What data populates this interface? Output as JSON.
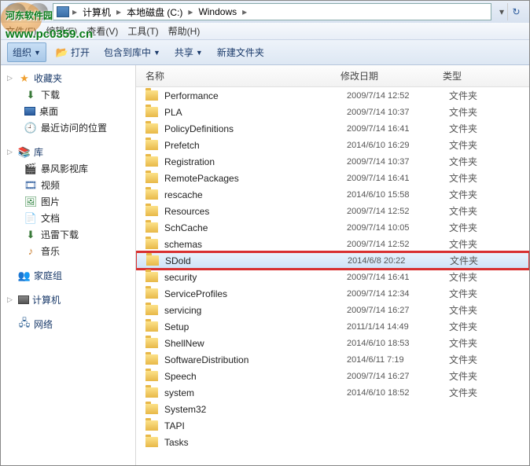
{
  "watermark": {
    "text": "河东软件园",
    "url": "www.pc0359.cn"
  },
  "breadcrumb": {
    "items": [
      "计算机",
      "本地磁盘 (C:)",
      "Windows"
    ]
  },
  "menubar": {
    "file": "文件(F)",
    "edit": "编辑(E)",
    "view": "查看(V)",
    "tools": "工具(T)",
    "help": "帮助(H)"
  },
  "toolbar": {
    "organize": "组织",
    "open": "打开",
    "include": "包含到库中",
    "share": "共享",
    "newfolder": "新建文件夹"
  },
  "sidebar": {
    "favorites": {
      "label": "收藏夹",
      "items": [
        {
          "icon": "download-icon",
          "label": "下载"
        },
        {
          "icon": "desktop-icon",
          "label": "桌面"
        },
        {
          "icon": "recent-icon",
          "label": "最近访问的位置"
        }
      ]
    },
    "libraries": {
      "label": "库",
      "items": [
        {
          "icon": "video-lib-icon",
          "label": "暴风影视库"
        },
        {
          "icon": "video-icon",
          "label": "视频"
        },
        {
          "icon": "picture-icon",
          "label": "图片"
        },
        {
          "icon": "document-icon",
          "label": "文档"
        },
        {
          "icon": "thunder-icon",
          "label": "迅雷下载"
        },
        {
          "icon": "music-icon",
          "label": "音乐"
        }
      ]
    },
    "homegroup": {
      "label": "家庭组"
    },
    "computer": {
      "label": "计算机"
    },
    "network": {
      "label": "网络"
    }
  },
  "columns": {
    "name": "名称",
    "date": "修改日期",
    "type": "类型"
  },
  "files": [
    {
      "name": "Performance",
      "date": "2009/7/14 12:52",
      "type": "文件夹"
    },
    {
      "name": "PLA",
      "date": "2009/7/14 10:37",
      "type": "文件夹"
    },
    {
      "name": "PolicyDefinitions",
      "date": "2009/7/14 16:41",
      "type": "文件夹"
    },
    {
      "name": "Prefetch",
      "date": "2014/6/10 16:29",
      "type": "文件夹"
    },
    {
      "name": "Registration",
      "date": "2009/7/14 10:37",
      "type": "文件夹"
    },
    {
      "name": "RemotePackages",
      "date": "2009/7/14 16:41",
      "type": "文件夹"
    },
    {
      "name": "rescache",
      "date": "2014/6/10 15:58",
      "type": "文件夹"
    },
    {
      "name": "Resources",
      "date": "2009/7/14 12:52",
      "type": "文件夹"
    },
    {
      "name": "SchCache",
      "date": "2009/7/14 10:05",
      "type": "文件夹"
    },
    {
      "name": "schemas",
      "date": "2009/7/14 12:52",
      "type": "文件夹"
    },
    {
      "name": "SDold",
      "date": "2014/6/8 20:22",
      "type": "文件夹",
      "selected": true,
      "highlight": true
    },
    {
      "name": "security",
      "date": "2009/7/14 16:41",
      "type": "文件夹"
    },
    {
      "name": "ServiceProfiles",
      "date": "2009/7/14 12:34",
      "type": "文件夹"
    },
    {
      "name": "servicing",
      "date": "2009/7/14 16:27",
      "type": "文件夹"
    },
    {
      "name": "Setup",
      "date": "2011/1/14 14:49",
      "type": "文件夹"
    },
    {
      "name": "ShellNew",
      "date": "2014/6/10 18:53",
      "type": "文件夹"
    },
    {
      "name": "SoftwareDistribution",
      "date": "2014/6/11 7:19",
      "type": "文件夹"
    },
    {
      "name": "Speech",
      "date": "2009/7/14 16:27",
      "type": "文件夹"
    },
    {
      "name": "system",
      "date": "2014/6/10 18:52",
      "type": "文件夹"
    },
    {
      "name": "System32",
      "date": "",
      "type": ""
    },
    {
      "name": "TAPI",
      "date": "",
      "type": ""
    },
    {
      "name": "Tasks",
      "date": "",
      "type": ""
    }
  ]
}
